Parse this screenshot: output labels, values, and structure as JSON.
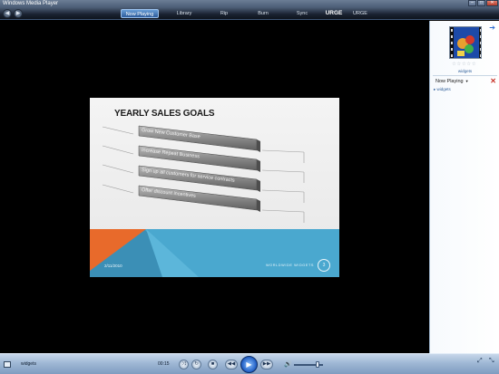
{
  "window": {
    "title": "Windows Media Player",
    "controls": {
      "minimize": "–",
      "maximize": "□",
      "close": "✕"
    }
  },
  "navigation": {
    "back": "◀",
    "forward": "▶",
    "tabs": [
      {
        "label": "Now Playing",
        "active": true
      },
      {
        "label": "Library",
        "active": false
      },
      {
        "label": "Rip",
        "active": false
      },
      {
        "label": "Burn",
        "active": false
      },
      {
        "label": "Sync",
        "active": false
      },
      {
        "label": "URGE",
        "active": false,
        "logo": true
      },
      {
        "label": "URGE",
        "active": false
      }
    ]
  },
  "slide": {
    "title": "YEARLY SALES GOALS",
    "items": [
      "Grow New Customer Base",
      "Increase Repeat Business",
      "Sign up all customers for service contracts",
      "Offer discount incentives"
    ],
    "date": "2/11/2010",
    "company": "WORLDWIDE WIDGETS",
    "page_number": "3",
    "colors": {
      "orange": "#e86a2b",
      "blue": "#4aa8cf",
      "teal": "#3b8fb6"
    }
  },
  "side_panel": {
    "arrow_icon": "arrow-right-icon",
    "album_name": "widgets",
    "rating_stars": "☆☆☆☆☆",
    "playlist_header": "Now Playing",
    "playlist_caret": "▼",
    "clear_icon": "✕",
    "playlist_items": [
      "widgets"
    ]
  },
  "control_bar": {
    "track_title": "widgets",
    "elapsed_time": "00:15",
    "shuffle": "⤨",
    "repeat": "↻",
    "stop": "■",
    "previous": "◀◀",
    "play": "▶",
    "next": "▶▶",
    "volume_icon": "🔊",
    "volume_level": 0.7,
    "switch_mode": "⤢",
    "fullscreen": "⤡"
  }
}
